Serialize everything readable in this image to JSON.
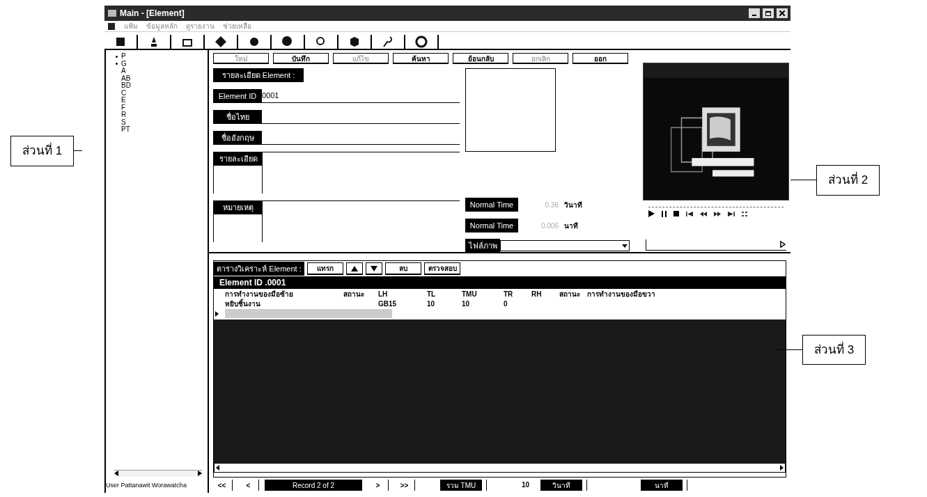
{
  "annotations": [
    {
      "label": "ส่วนที่ 1"
    },
    {
      "label": "ส่วนที่ 2"
    },
    {
      "label": "ส่วนที่ 3"
    }
  ],
  "window": {
    "title": "Main - [Element]"
  },
  "menu": [
    "แฟ้ม",
    "ข้อมูลหลัก",
    "ดูรายงาน",
    "ช่วยเหลือ"
  ],
  "tree": [
    {
      "label": "P",
      "expandable": true
    },
    {
      "label": "G",
      "expandable": true
    },
    {
      "label": "A",
      "expandable": false
    },
    {
      "label": "AB",
      "expandable": false
    },
    {
      "label": "BD",
      "expandable": false
    },
    {
      "label": "C",
      "expandable": false
    },
    {
      "label": "E",
      "expandable": false
    },
    {
      "label": "F",
      "expandable": false
    },
    {
      "label": "R",
      "expandable": false
    },
    {
      "label": "S",
      "expandable": false
    },
    {
      "label": "PT",
      "expandable": false
    }
  ],
  "action_buttons": [
    {
      "label": "ใหม่",
      "disabled": true
    },
    {
      "label": "บันทึก",
      "disabled": false
    },
    {
      "label": "แก้ไข",
      "disabled": true
    },
    {
      "label": "ค้นหา",
      "disabled": false
    },
    {
      "label": "ย้อนกลับ",
      "disabled": false
    },
    {
      "label": "ยกเลิก",
      "disabled": true
    },
    {
      "label": "ออก",
      "disabled": false
    }
  ],
  "form": {
    "heading": "รายละเอียด Element :",
    "fields": [
      {
        "label": "Element ID",
        "value": "0001",
        "kind": "line"
      },
      {
        "label": "ชื่อไทย",
        "kind": "line"
      },
      {
        "label": "ชื่ออังกฤษ",
        "kind": "line"
      },
      {
        "label": "รายละเอียด",
        "kind": "multiline"
      },
      {
        "label": "หมายเหตุ",
        "kind": "multiline"
      }
    ],
    "times": [
      {
        "label": "Normal Time",
        "value": "0.36",
        "unit": "วินาที"
      },
      {
        "label": "Normal Time",
        "value": "0.006",
        "unit": "นาที"
      }
    ],
    "file_label": "ไฟล์ภาพ"
  },
  "grid": {
    "title": "ตารางวิเคราะห์ Element :",
    "buttons": [
      {
        "label": "แทรก",
        "kind": "text"
      },
      {
        "kind": "up"
      },
      {
        "kind": "down"
      },
      {
        "label": "ลบ",
        "kind": "text"
      },
      {
        "label": "ตรวจสอบ",
        "kind": "text"
      }
    ],
    "caption": "Element ID .0001",
    "columns": [
      "การทำงานของมือซ้าย",
      "สถานะ",
      "LH",
      "TL",
      "TMU",
      "TR",
      "RH",
      "สถานะ",
      "การทำงานของมือขวา"
    ],
    "rows": [
      {
        "cells": [
          "หยิบชิ้นงาน",
          "",
          "GB15",
          "10",
          "10",
          "0",
          "",
          "",
          ""
        ],
        "selected": false
      },
      {
        "cells": [
          "",
          "",
          "",
          "",
          "",
          "",
          "",
          "",
          ""
        ],
        "selected": true
      }
    ]
  },
  "navigation": {
    "buttons": [
      "<<",
      "<",
      ">",
      ">>"
    ],
    "record": "Record 2 of 2"
  },
  "totals": [
    {
      "label": "รวม TMU",
      "value": "10"
    },
    {
      "label": "วินาที"
    },
    {
      "label": "นาที"
    }
  ],
  "status_bar": "User  Pattanawit Worawatcha"
}
